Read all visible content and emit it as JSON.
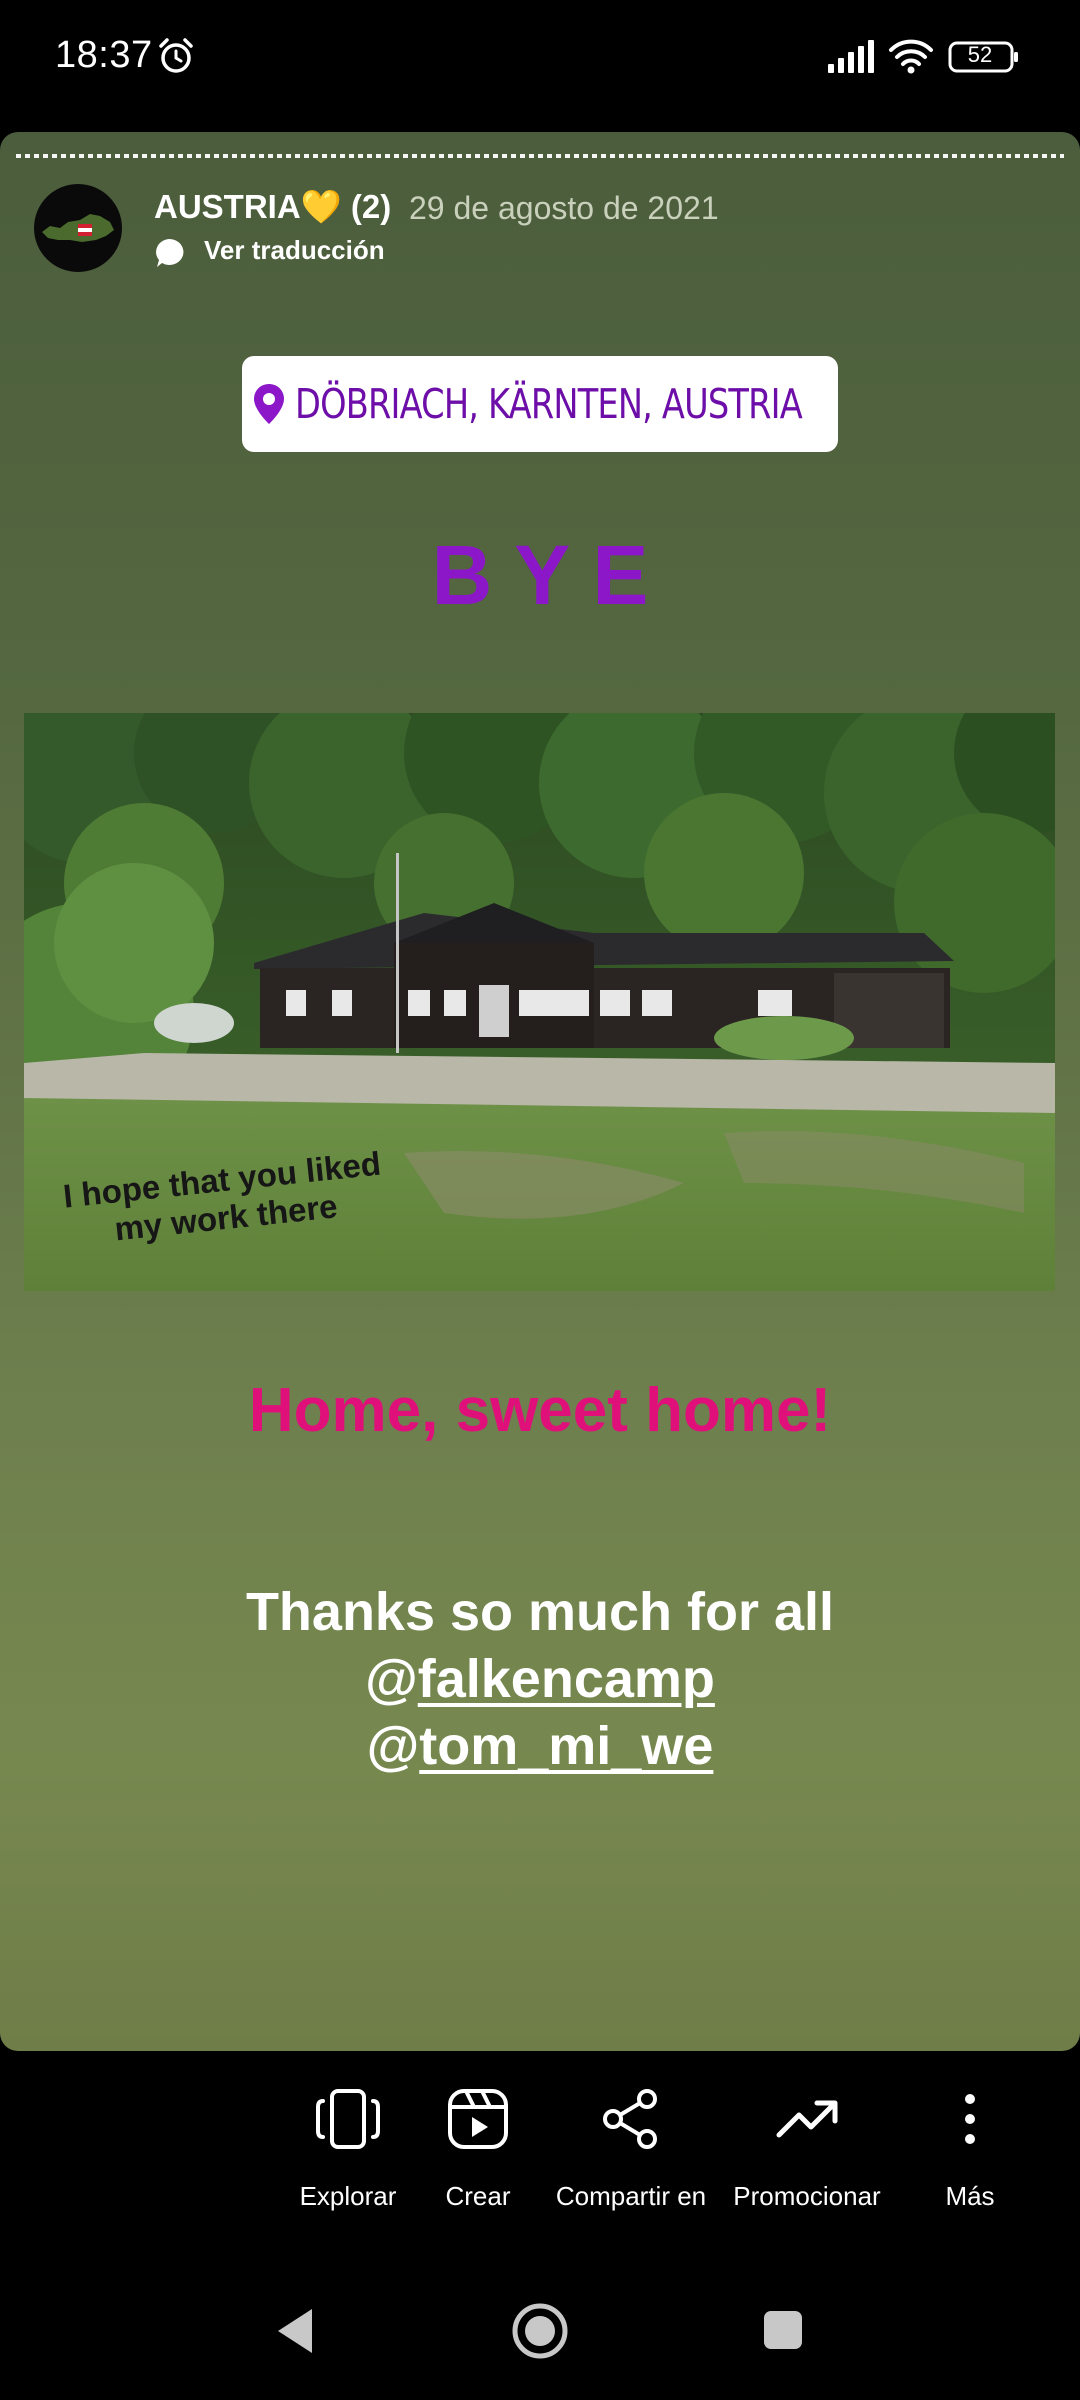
{
  "status_bar": {
    "time": "18:37",
    "battery": "52",
    "icons": [
      "alarm-icon",
      "signal-icon",
      "wifi-icon",
      "battery-icon"
    ]
  },
  "story": {
    "title": "AUSTRIA💛 (2)",
    "date": "29 de agosto de 2021",
    "translate_label": "Ver traducción",
    "location": "DÖBRIACH, KÄRNTEN, AUSTRIA",
    "bye": "BYE",
    "photo_caption": "I hope that you liked my work there",
    "home_text": "Home, sweet home!",
    "thanks_line": "Thanks so much for all",
    "mentions": [
      "falkencamp",
      "tom_mi_we"
    ],
    "mention_prefix": "@",
    "colors": {
      "location_text": "#6d0ea9",
      "bye": "#8b17c9",
      "home_text": "#e0107a"
    }
  },
  "actions": [
    {
      "label": "Explorar",
      "icon": "explore-icon"
    },
    {
      "label": "Crear",
      "icon": "reels-icon"
    },
    {
      "label": "Compartir en",
      "icon": "share-icon"
    },
    {
      "label": "Promocionar",
      "icon": "trending-icon"
    },
    {
      "label": "Más",
      "icon": "more-vertical-icon"
    }
  ],
  "nav": [
    "back-icon",
    "home-icon",
    "recents-icon"
  ]
}
